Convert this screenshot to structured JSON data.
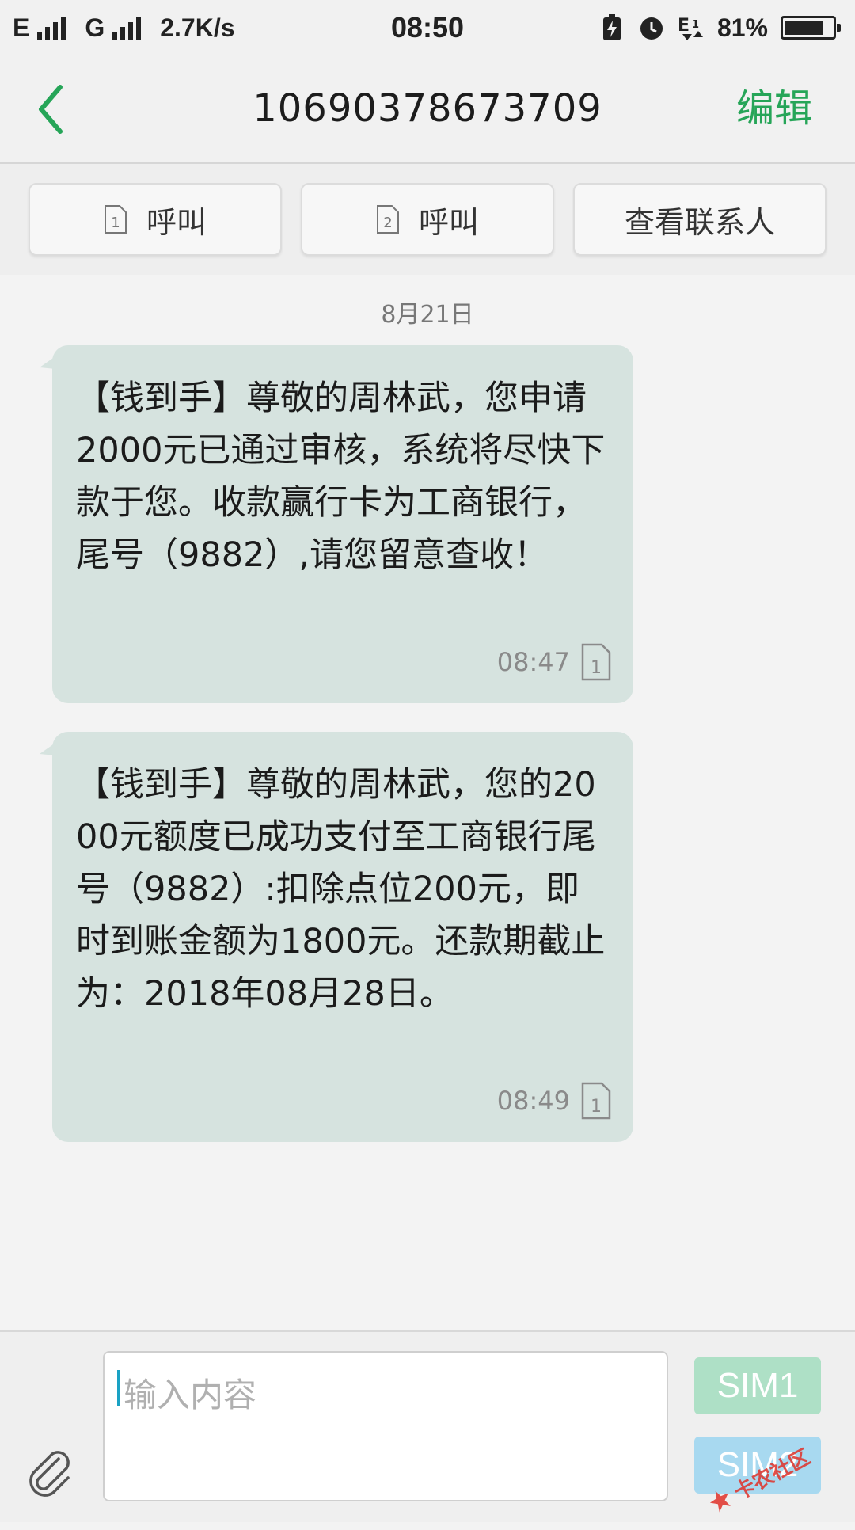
{
  "status_bar": {
    "net1": "E",
    "net2": "G",
    "speed": "2.7K/s",
    "time": "08:50",
    "battery_pct": "81%",
    "battery_level": 0.81
  },
  "header": {
    "title": "10690378673709",
    "edit_label": "编辑"
  },
  "actions": [
    {
      "label": "呼叫",
      "sim": "1"
    },
    {
      "label": "呼叫",
      "sim": "2"
    },
    {
      "label": "查看联系人"
    }
  ],
  "conversation": {
    "date": "8月21日",
    "messages": [
      {
        "text": "【钱到手】尊敬的周林武，您申请2000元已通过审核，系统将尽快下款于您。收款赢行卡为工商银行，尾号（9882）,请您留意查收！",
        "time": "08:47",
        "sim": "1"
      },
      {
        "text": "【钱到手】尊敬的周林武，您的2000元额度已成功支付至工商银行尾号（9882）:扣除点位200元，即时到账金额为1800元。还款期截止为：2018年08月28日。",
        "time": "08:49",
        "sim": "1"
      }
    ]
  },
  "composer": {
    "placeholder": "输入内容",
    "send_sim1": "SIM1",
    "send_sim2": "SIM2"
  },
  "watermark": "卡农社区"
}
